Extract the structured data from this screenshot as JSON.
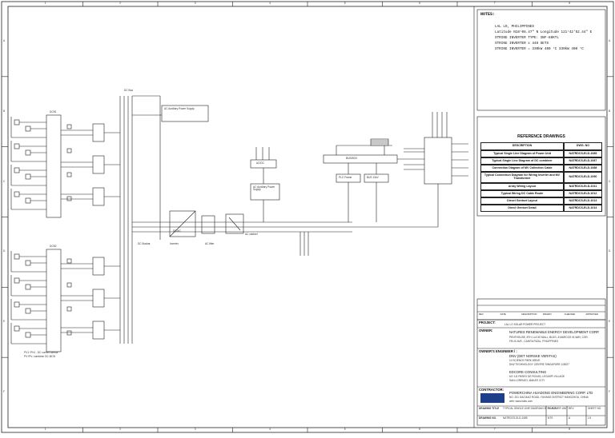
{
  "grid": {
    "columns": [
      "1",
      "2",
      "3",
      "4",
      "5",
      "6",
      "7",
      "8"
    ],
    "rows": [
      "A",
      "B",
      "C",
      "D",
      "E",
      "F"
    ]
  },
  "labels": {
    "dc_bus": "DC Bus",
    "ac_aux_1": "AC Auxiliary Power Supply",
    "ac_aux_2": "AC Auxiliary Power Supply",
    "ac_dc": "AC/DC",
    "plc_frame": "PLC Frame",
    "bus_box": "BUS/BOX",
    "bus_10kv": "BUS 10kV",
    "dcbox_1": "DCB1",
    "dcbox_2": "DCB2",
    "inverter_block": "DC/AC",
    "dc_busbar": "DC Busbar",
    "inverter": "Inverter",
    "ac_filter": "AC filter",
    "ac_cabinet": "AC cabinet",
    "dc_footnote_1": "PV1~PV4 - DC current sensor",
    "dc_footnote_2": "PV+PV- combiner DC MCB"
  },
  "notes": {
    "title": "NOTES:",
    "lines": [
      "LAL LO, PHILIPPINES",
      "Latitude N18°08.47\"  N      Longitude 121°42'52.44\"  E",
      "STRING INVERTER TYPE: IBF-88KTL",
      "STRING INVERTER  x  448  SETS",
      "STRING INVERTER  =  330kW  400 °C          330kW  400 °C"
    ]
  },
  "reference": {
    "title": "REFERENCE DRAWINGS",
    "col_desc": "DESCRIPTION",
    "col_no": "DWG. NO",
    "rows": [
      {
        "desc": "Typical Single Line Diagram of  Power Unit",
        "no": "NATRDCS-ELD-1085"
      },
      {
        "desc": "Typical Single Line Diagram of DC combiner",
        "no": "NATRDCS-ELD-1087"
      },
      {
        "desc": "Connection Diagram of MV Collection Cable",
        "no": "NATRDCS-ELD-1088"
      },
      {
        "desc": "Typical Connection Diagram for Wiring Inverter and MV Transformer",
        "no": "NATRDCS-ELD-1090"
      },
      {
        "desc": "Array Wiring Layout",
        "no": "NATRDCS-ELD-1011"
      },
      {
        "desc": "Typical Wiring DC Cable Route",
        "no": "NATRDCS-ELD-1012"
      },
      {
        "desc": "Diesel Gentset Layout",
        "no": "NATRDCS-ELD-1013"
      },
      {
        "desc": "Direct Gentset Detail",
        "no": "NATRDCS-ELD-1014"
      }
    ]
  },
  "title_block": {
    "project_label": "PROJECT:",
    "project": "LAL LO SOLAR POWER PROJECT",
    "owner_label": "OWNER:",
    "owner_name": "NATURES RENEWABLE ENERGY DEVELOPMENT CORP.",
    "owner_addr_1": "PENTHOUSE, 8TH, LUCIO MALL, BLDG, 8 MARCOS HI-WAY, COR.",
    "owner_addr_2": "FELIX AVE., CAINTA RIZAL, PHILIPPINES",
    "consultant_label": "OWNER'S ENGINEER / :",
    "consultant_1": "DNV (DET NORSKE VERITAS)",
    "consultant_1_addr_1": "10 SCIENCE PARK DRIVE",
    "consultant_1_addr_2": "DNV TECHNOLOGY CENTRE SINGAPORE 118227",
    "consultant_2": "EDCORE CONSULTING",
    "consultant_2_addr_1": "UG 111 PASEO DE ROXAS, LEGASPI VILLAGE",
    "consultant_2_addr_2": "SAN LORENZO, MAKATI CITY",
    "contractor_label": "CONTRACTOR:",
    "contractor": "POWERCHINA HUADONG ENGINEERING CORP. LTD",
    "contractor_addr": "NO. 201 GAOJIAO ROAD, YUHANG DISTRICT HANGZHOU, CHINA",
    "contractor_web": "web: www.hdec.com",
    "drawing_title_label": "DRAWING TITLE",
    "drawing_title": "TYPICAL SINGLE LINE DIAGRAM OF PV POWER UNIT",
    "drawing_no_label": "DRAWING NO.",
    "drawing_no": "NATRDCS-ELD-1085",
    "scale_label": "SCALE",
    "scale": "NTS",
    "sheet_label": "SHEET NO.",
    "sheet": "1/1",
    "rev_label": "REV.",
    "rev": "A"
  },
  "revision_header": [
    "REV",
    "DATE",
    "DESCRIPTION",
    "DRAWN",
    "CHECKED",
    "APPROVED"
  ]
}
